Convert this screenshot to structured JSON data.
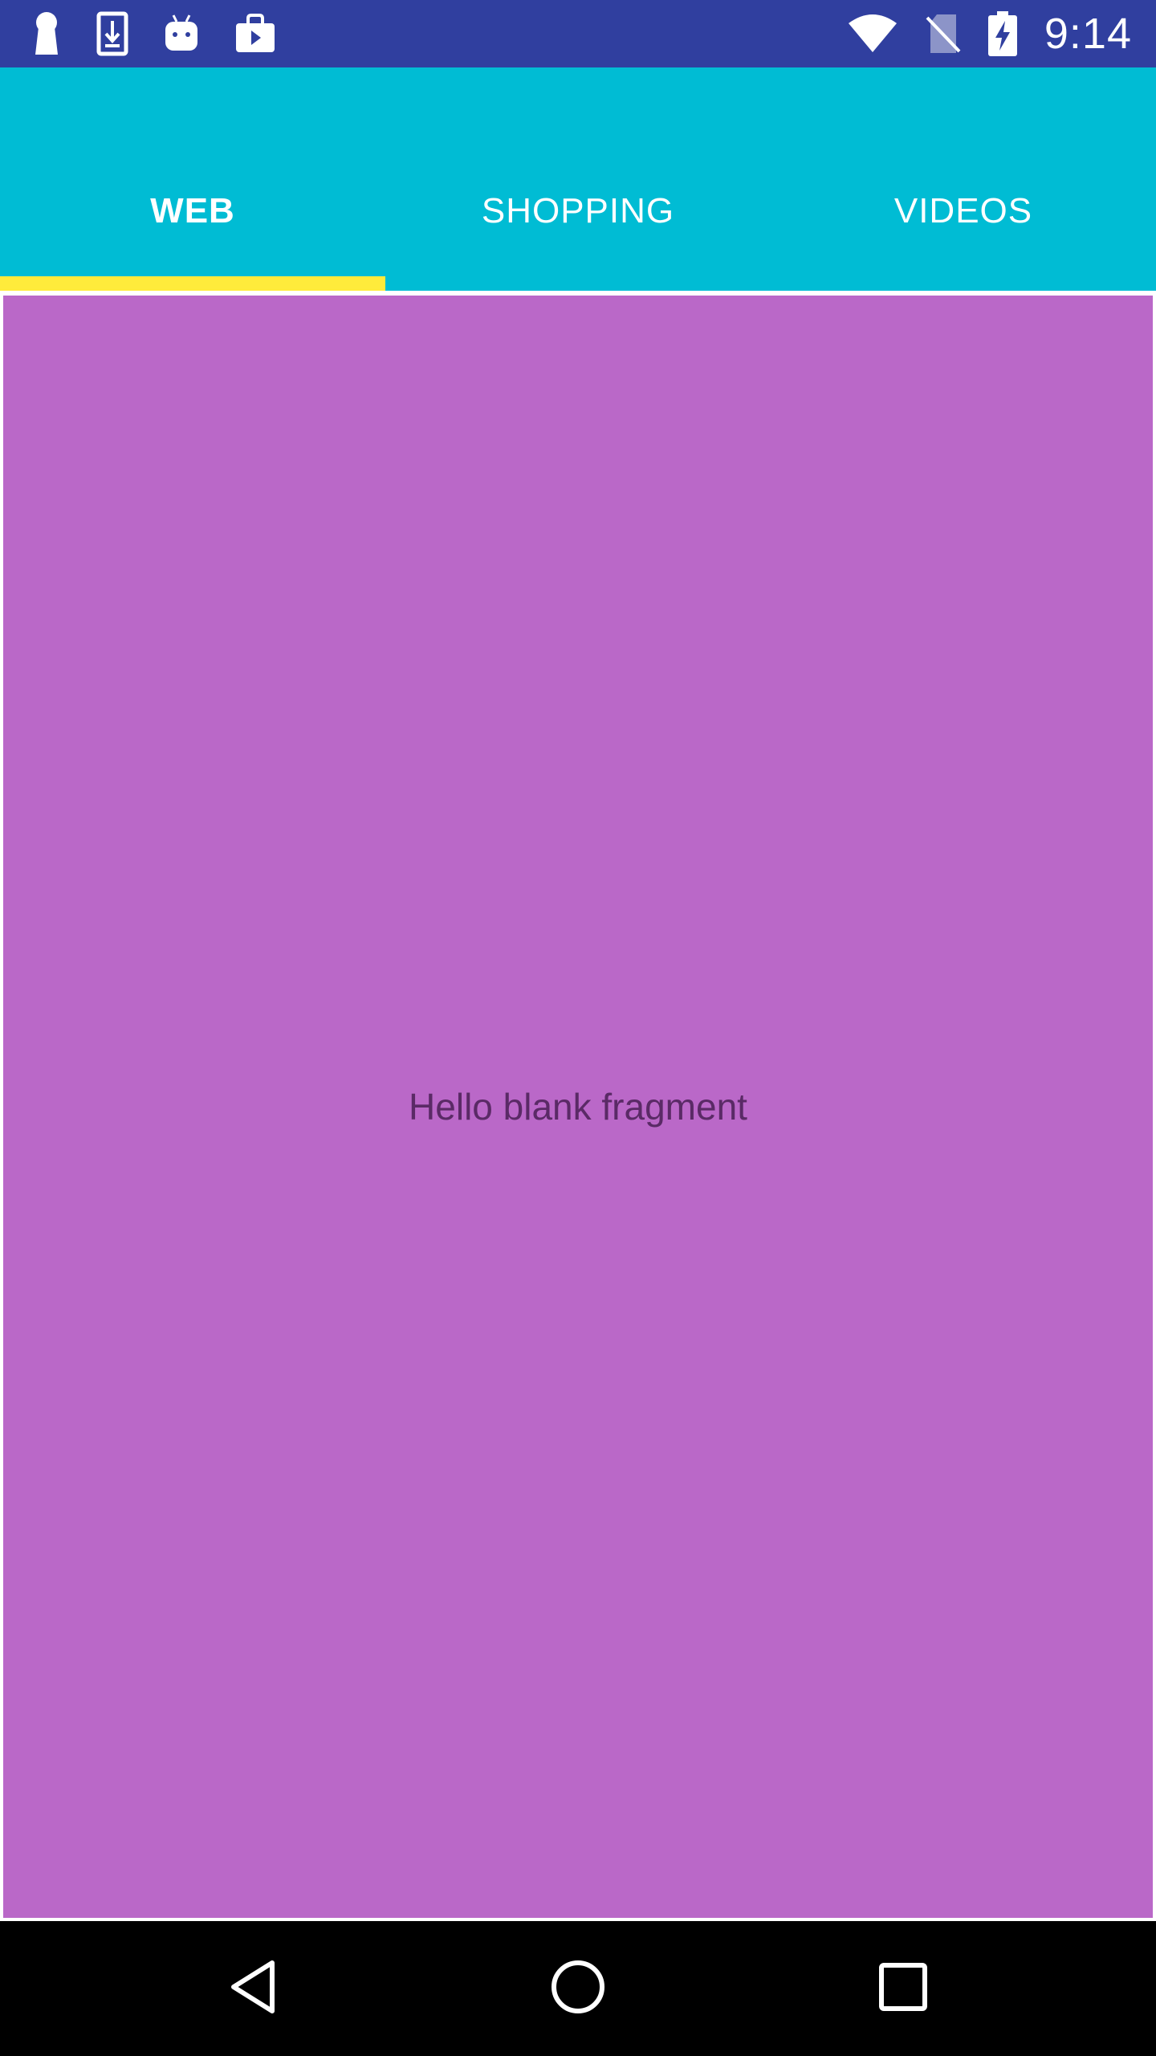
{
  "status_bar": {
    "time": "9:14",
    "left_icons": [
      "keyhole-icon",
      "download-icon",
      "android-icon",
      "store-icon"
    ],
    "right_icons": [
      "wifi-icon",
      "no-sim-icon",
      "battery-charging-icon"
    ],
    "background": "#303f9f"
  },
  "app_bar": {
    "background": "#00bcd4",
    "indicator_color": "#ffeb3b",
    "tabs": [
      {
        "label": "WEB",
        "selected": true
      },
      {
        "label": "SHOPPING",
        "selected": false
      },
      {
        "label": "VIDEOS",
        "selected": false
      }
    ]
  },
  "fragment": {
    "text": "Hello blank fragment",
    "background": "#ba68c8"
  },
  "nav_bar": {
    "buttons": [
      "back-icon",
      "home-icon",
      "recents-icon"
    ]
  }
}
